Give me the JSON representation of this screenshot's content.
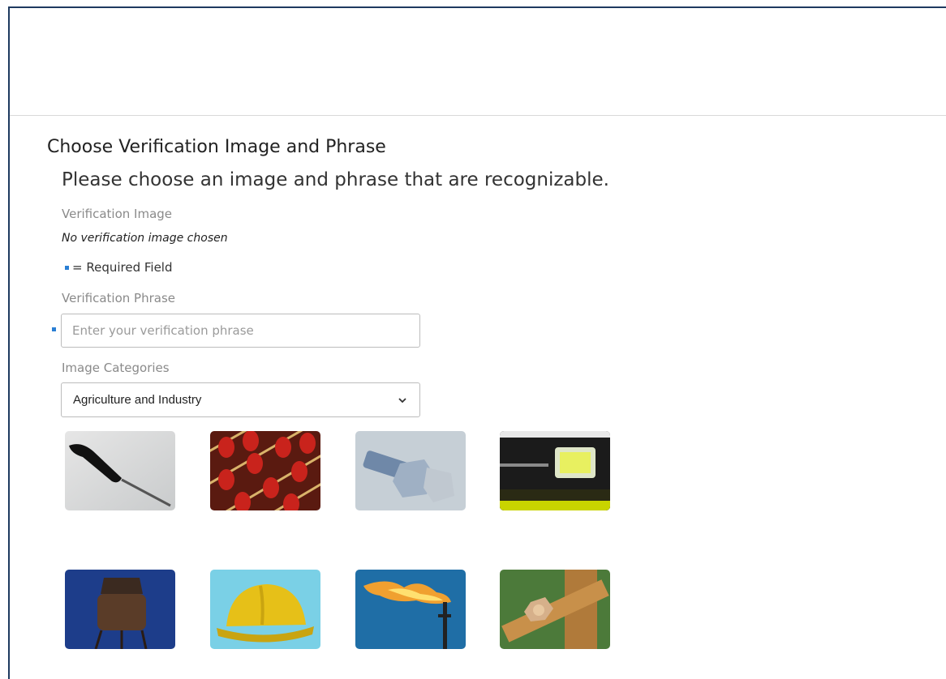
{
  "section_title": "Choose Verification Image and Phrase",
  "subtitle": "Please choose an image and phrase that are recognizable.",
  "verification_image": {
    "label": "Verification Image",
    "status": "No verification image chosen"
  },
  "required_note": "= Required Field",
  "verification_phrase": {
    "label": "Verification Phrase",
    "placeholder": "Enter your verification phrase",
    "value": ""
  },
  "image_categories": {
    "label": "Image Categories",
    "selected": "Agriculture and Industry"
  },
  "images": [
    {
      "name": "screwdriver"
    },
    {
      "name": "abacus"
    },
    {
      "name": "bolt-and-nut"
    },
    {
      "name": "spirit-level"
    },
    {
      "name": "water-tower"
    },
    {
      "name": "hard-hat"
    },
    {
      "name": "gas-flare"
    },
    {
      "name": "bolted-beam"
    }
  ],
  "colors": {
    "required_marker": "#2a7fd4",
    "frame_border": "#1e3a5f",
    "label_gray": "#8a8a8a"
  }
}
